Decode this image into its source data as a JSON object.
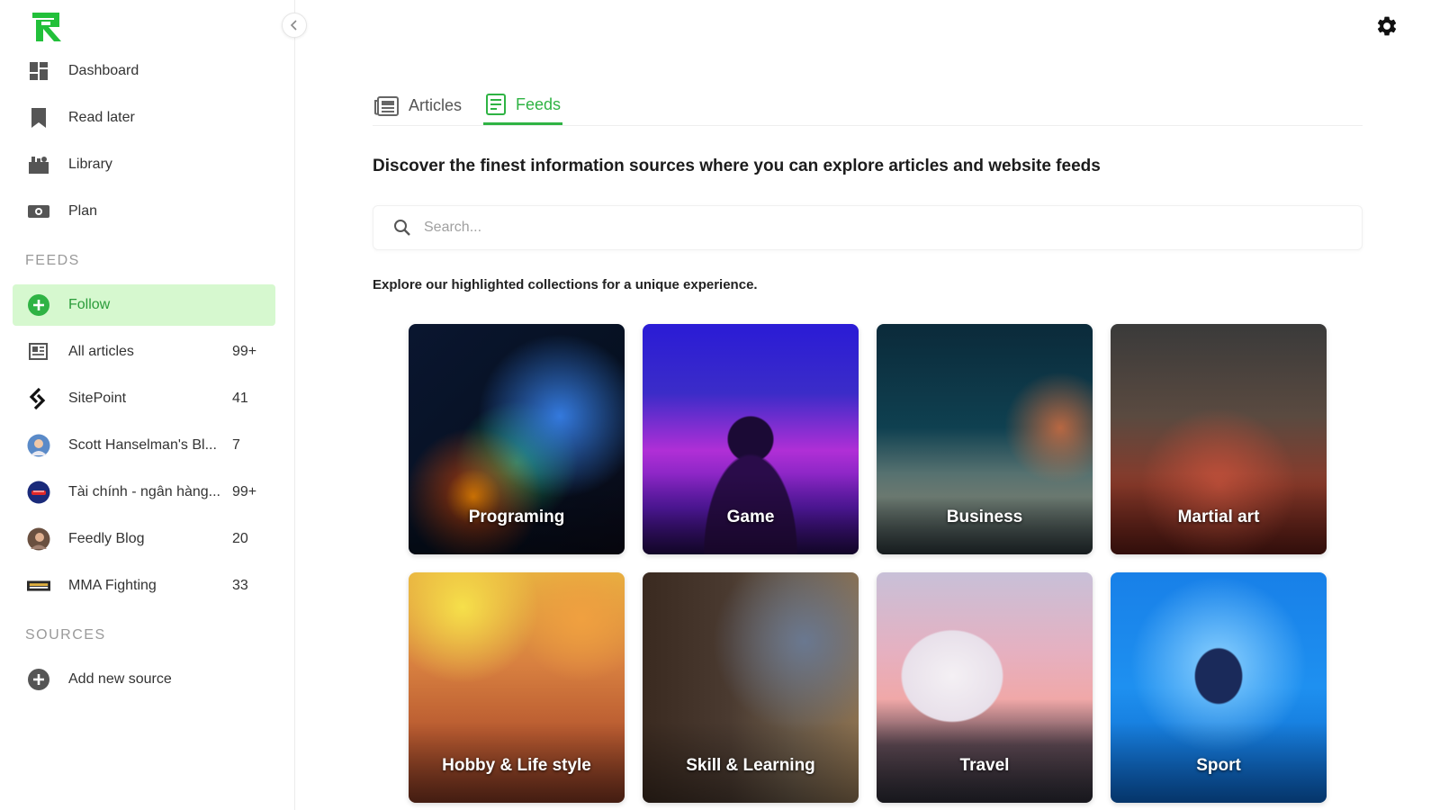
{
  "sidebar": {
    "nav": [
      {
        "label": "Dashboard",
        "icon": "dashboard-icon"
      },
      {
        "label": "Read later",
        "icon": "bookmark-icon"
      },
      {
        "label": "Library",
        "icon": "library-icon"
      },
      {
        "label": "Plan",
        "icon": "plan-icon"
      }
    ],
    "feeds_title": "FEEDS",
    "feeds": [
      {
        "label": "Follow",
        "count": "",
        "icon": "plus-circle-icon"
      },
      {
        "label": "All articles",
        "count": "99+",
        "icon": "articles-icon"
      },
      {
        "label": "SitePoint",
        "count": "41",
        "icon": "sitepoint-icon"
      },
      {
        "label": "Scott Hanselman's Bl...",
        "count": "7",
        "icon": "avatar-icon"
      },
      {
        "label": "Tài chính - ngân hàng...",
        "count": "99+",
        "icon": "avatar-icon"
      },
      {
        "label": "Feedly Blog",
        "count": "20",
        "icon": "avatar-icon"
      },
      {
        "label": "MMA Fighting",
        "count": "33",
        "icon": "mma-icon"
      }
    ],
    "sources_title": "SOURCES",
    "sources": [
      {
        "label": "Add new source",
        "icon": "plus-circle-icon"
      }
    ]
  },
  "tabs": [
    {
      "label": "Articles",
      "active": false
    },
    {
      "label": "Feeds",
      "active": true
    }
  ],
  "headline": "Discover the finest information sources where you can explore articles and website feeds",
  "search": {
    "placeholder": "Search..."
  },
  "subtitle": "Explore our highlighted collections for a unique experience.",
  "collections": [
    {
      "title": "Programing"
    },
    {
      "title": "Game"
    },
    {
      "title": "Business"
    },
    {
      "title": "Martial art"
    },
    {
      "title": "Hobby & Life style"
    },
    {
      "title": "Skill & Learning"
    },
    {
      "title": "Travel"
    },
    {
      "title": "Sport"
    }
  ],
  "colors": {
    "accent": "#2fb344",
    "active_bg": "#d6f8cf"
  }
}
